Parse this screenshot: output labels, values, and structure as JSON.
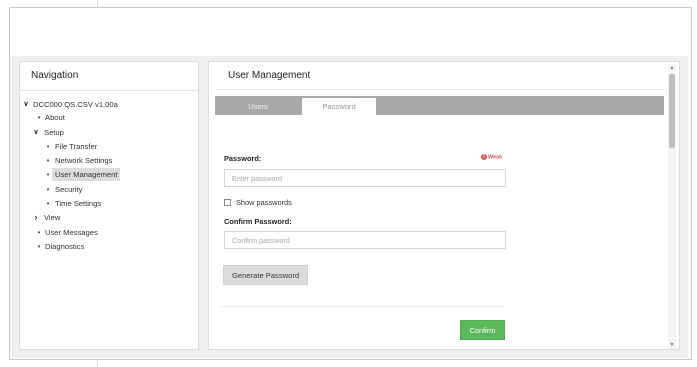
{
  "navigation": {
    "title": "Navigation",
    "tree": [
      {
        "label": "DCC000 QS.CSV v1.00a",
        "marker": "v"
      },
      {
        "label": "About",
        "marker": "•"
      },
      {
        "label": "Setup",
        "marker": "v"
      },
      {
        "label": "File Transfer",
        "marker": "•"
      },
      {
        "label": "Network Settings",
        "marker": "•"
      },
      {
        "label": "User Management",
        "marker": "•",
        "selected": true
      },
      {
        "label": "Security",
        "marker": "•"
      },
      {
        "label": "Time Settings",
        "marker": "•"
      },
      {
        "label": "View",
        "marker": ">"
      },
      {
        "label": "User Messages",
        "marker": "•"
      },
      {
        "label": "Diagnostics",
        "marker": "•"
      }
    ]
  },
  "user_management": {
    "title": "User Management",
    "tabs": [
      {
        "label": "Users",
        "active": false
      },
      {
        "label": "Password",
        "active": true
      }
    ],
    "password": {
      "label": "Password:",
      "placeholder": "Enter password",
      "strength": "Weak",
      "strength_icon": "!"
    },
    "show_passwords_label": "Show passwords",
    "confirm": {
      "label": "Confirm Password:",
      "placeholder": "Confirm password"
    },
    "generate_button": "Generate Password",
    "confirm_button": "Confirm"
  },
  "icons": {
    "expanded": "chevron-down-icon",
    "collapsed": "chevron-right-icon",
    "scroll_up": "scroll-up-icon",
    "scroll_down": "scroll-down-icon"
  },
  "colors": {
    "confirm_button": "#5cb85c",
    "tab_bar": "#a9a9a9",
    "weak_indicator": "#d9534f"
  }
}
